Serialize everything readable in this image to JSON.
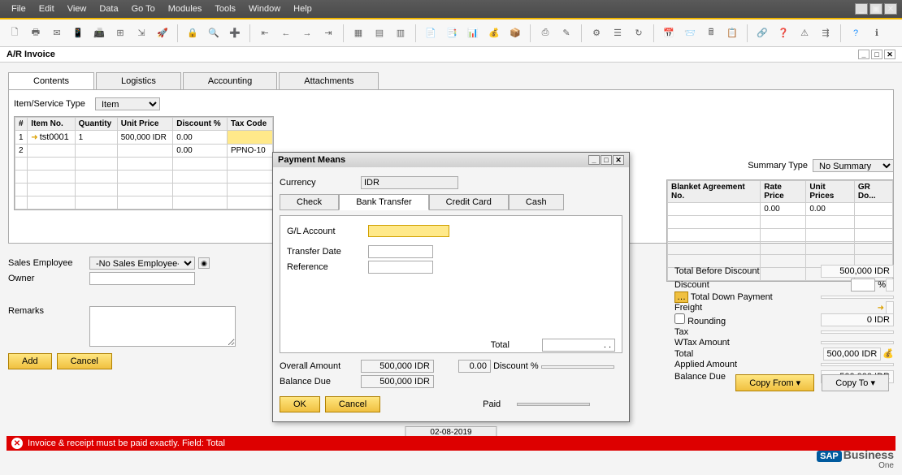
{
  "menu": [
    "File",
    "Edit",
    "View",
    "Data",
    "Go To",
    "Modules",
    "Tools",
    "Window",
    "Help"
  ],
  "window_title": "A/R Invoice",
  "tabs": [
    "Contents",
    "Logistics",
    "Accounting",
    "Attachments"
  ],
  "active_tab": 0,
  "item_service_type_label": "Item/Service Type",
  "item_service_type_value": "Item",
  "summary_type_label": "Summary Type",
  "summary_type_value": "No Summary",
  "grid_left": {
    "headers": [
      "#",
      "Item No.",
      "Quantity",
      "Unit Price",
      "Discount %",
      "Tax Code"
    ],
    "rows": [
      [
        "1",
        "tst0001",
        "1",
        "500,000 IDR",
        "0.00",
        ""
      ],
      [
        "2",
        "",
        "",
        "",
        "0.00",
        "PPNO-10"
      ]
    ]
  },
  "grid_right": {
    "headers": [
      "Blanket Agreement No.",
      "Rate Price",
      "Unit Prices",
      "GR Do..."
    ],
    "rows": [
      [
        "",
        "0.00",
        "0.00",
        ""
      ]
    ]
  },
  "sales_emp_label": "Sales Employee",
  "sales_emp_value": "-No Sales Employee-",
  "owner_label": "Owner",
  "remarks_label": "Remarks",
  "btn_add": "Add",
  "btn_cancel": "Cancel",
  "btn_copy_from": "Copy From",
  "btn_copy_to": "Copy To",
  "summary": {
    "total_before_discount_label": "Total Before Discount",
    "total_before_discount": "500,000 IDR",
    "discount_label": "Discount",
    "discount_pct": "",
    "discount_unit": "%",
    "total_down_payment_label": "Total Down Payment",
    "total_down_payment": "",
    "freight_label": "Freight",
    "freight": "",
    "rounding_label": "Rounding",
    "rounding": "0 IDR",
    "tax_label": "Tax",
    "tax": "",
    "wtax_label": "WTax Amount",
    "wtax": "",
    "total_label": "Total",
    "total": "500,000 IDR",
    "applied_label": "Applied Amount",
    "applied": "",
    "balance_due_label": "Balance Due",
    "balance_due": "500,000 IDR"
  },
  "status_error": "Invoice & receipt must be paid exactly.  Field: Total",
  "footer_date": "02-08-2019",
  "modal": {
    "title": "Payment Means",
    "currency_label": "Currency",
    "currency": "IDR",
    "tabs": [
      "Check",
      "Bank Transfer",
      "Credit Card",
      "Cash"
    ],
    "active": 1,
    "gl_label": "G/L Account",
    "gl": "",
    "transfer_date_label": "Transfer Date",
    "transfer_date": "",
    "reference_label": "Reference",
    "reference": "",
    "total_label": "Total",
    "total": ". .",
    "overall_label": "Overall Amount",
    "overall": "500,000 IDR",
    "discount_label": "Discount %",
    "discount_val": "0.00",
    "discount_amt": "",
    "balance_label": "Balance Due",
    "balance": "500,000 IDR",
    "paid_label": "Paid",
    "paid": "",
    "ok": "OK",
    "cancel": "Cancel"
  }
}
